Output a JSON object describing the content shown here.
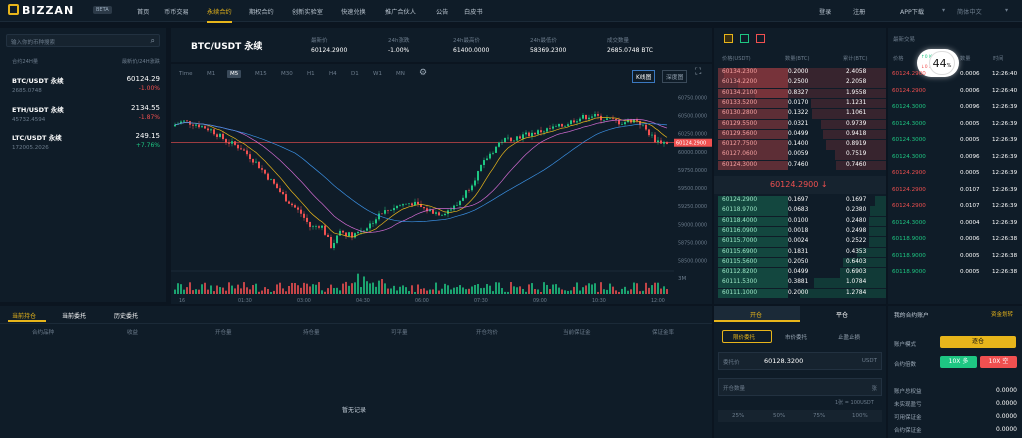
{
  "nav": {
    "logo": "BIZZAN",
    "beta": "BETA",
    "items": [
      "首页",
      "币币交易",
      "永续合约",
      "期权合约",
      "创新实验室",
      "快速兑换",
      "推广合伙人",
      "公告",
      "白皮书"
    ],
    "active_index": 2,
    "right": [
      "登录",
      "注册",
      "APP下载",
      "简体中文"
    ]
  },
  "left": {
    "search_placeholder": "输入你的币种搜索",
    "head_left": "合约24H量",
    "head_right": "最新价/24H涨跌",
    "symbols": [
      {
        "name": "BTC/USDT 永续",
        "vol": "2685.0748",
        "price": "60124.29",
        "change": "-1.00%",
        "dir": "down"
      },
      {
        "name": "ETH/USDT 永续",
        "vol": "45732.4594",
        "price": "2134.55",
        "change": "-1.87%",
        "dir": "down"
      },
      {
        "name": "LTC/USDT 永续",
        "vol": "172005.2026",
        "price": "249.15",
        "change": "+7.76%",
        "dir": "up"
      }
    ]
  },
  "ticker": {
    "symbol": "BTC/USDT 永续",
    "stats": [
      {
        "label": "最新价",
        "value": "60124.2900",
        "color": "red"
      },
      {
        "label": "24h涨跌",
        "value": "-1.00%",
        "color": "red"
      },
      {
        "label": "24h最高价",
        "value": "61400.0000",
        "color": "white"
      },
      {
        "label": "24h最低价",
        "value": "58369.2300",
        "color": "white"
      },
      {
        "label": "成交数量",
        "value": "2685.0748 BTC",
        "color": "white"
      }
    ]
  },
  "chart_toolbar": {
    "intervals": [
      "Time",
      "M1",
      "M5",
      "M15",
      "M30",
      "H1",
      "H4",
      "D1",
      "W1",
      "MN"
    ],
    "active_interval": "M5",
    "kline_btn": "K线图",
    "depth_btn": "深度图"
  },
  "chart_data": {
    "type": "candlestick",
    "xlabels": [
      "16",
      "01:30",
      "03:00",
      "04:30",
      "06:00",
      "07:30",
      "09:00",
      "10:30",
      "12:00"
    ],
    "ylabels": [
      "60750.0000",
      "60500.0000",
      "60250.0000",
      "60000.0000",
      "59750.0000",
      "59500.0000",
      "59250.0000",
      "59000.0000",
      "58750.0000",
      "58500.0000"
    ],
    "last_price_label": "60124.2900",
    "volume_label": "3M"
  },
  "orderbook": {
    "headers": [
      "价格(USDT)",
      "数量(BTC)",
      "累计(BTC)"
    ],
    "asks": [
      [
        "60134.2300",
        "0.2000",
        "2.4058"
      ],
      [
        "60134.2200",
        "0.2500",
        "2.2058"
      ],
      [
        "60134.2100",
        "0.8327",
        "1.9558"
      ],
      [
        "60133.5200",
        "0.0170",
        "1.1231"
      ],
      [
        "60130.2800",
        "0.1322",
        "1.1061"
      ],
      [
        "60129.5500",
        "0.0321",
        "0.9739"
      ],
      [
        "60129.5600",
        "0.0499",
        "0.9418"
      ],
      [
        "60127.7500",
        "0.1400",
        "0.8919"
      ],
      [
        "60127.0600",
        "0.0059",
        "0.7519"
      ],
      [
        "60124.3000",
        "0.7460",
        "0.7460"
      ]
    ],
    "mid_price": "60124.2900 ↓",
    "bids": [
      [
        "60124.2900",
        "0.1697",
        "0.1697"
      ],
      [
        "60118.9700",
        "0.0683",
        "0.2380"
      ],
      [
        "60118.4000",
        "0.0100",
        "0.2480"
      ],
      [
        "60116.0900",
        "0.0018",
        "0.2498"
      ],
      [
        "60115.7000",
        "0.0024",
        "0.2522"
      ],
      [
        "60115.6900",
        "0.1831",
        "0.4353"
      ],
      [
        "60115.5600",
        "0.2050",
        "0.6403"
      ],
      [
        "60112.8200",
        "0.0499",
        "0.6903"
      ],
      [
        "60111.5300",
        "0.3881",
        "1.0784"
      ],
      [
        "60111.1000",
        "0.2000",
        "1.2784"
      ]
    ]
  },
  "trades": {
    "title": "最新交易",
    "headers": [
      "价格",
      "数量",
      "时间"
    ],
    "rows": [
      [
        "60124.2900",
        "0.0006",
        "12:26:40",
        "red"
      ],
      [
        "60124.2900",
        "0.0006",
        "12:26:40",
        "red"
      ],
      [
        "60124.3000",
        "0.0096",
        "12:26:39",
        "green"
      ],
      [
        "60124.3000",
        "0.0005",
        "12:26:39",
        "green"
      ],
      [
        "60124.3000",
        "0.0005",
        "12:26:39",
        "green"
      ],
      [
        "60124.3000",
        "0.0096",
        "12:26:39",
        "green"
      ],
      [
        "60124.2900",
        "0.0005",
        "12:26:39",
        "red"
      ],
      [
        "60124.2900",
        "0.0107",
        "12:26:39",
        "red"
      ],
      [
        "60124.2900",
        "0.0107",
        "12:26:39",
        "red"
      ],
      [
        "60124.3000",
        "0.0004",
        "12:26:39",
        "green"
      ],
      [
        "60118.9000",
        "0.0006",
        "12:26:38",
        "green"
      ],
      [
        "60118.9000",
        "0.0005",
        "12:26:38",
        "green"
      ],
      [
        "60118.9000",
        "0.0005",
        "12:26:38",
        "green"
      ]
    ],
    "speed_badge": "44",
    "speed_unit": "%",
    "speed_up": "0",
    "speed_down": "0",
    "speed_unit_label": "K/s"
  },
  "positions": {
    "tabs": [
      "当前持仓",
      "当前委托",
      "历史委托"
    ],
    "columns": [
      "合约品种",
      "收益",
      "开仓量",
      "持仓量",
      "可平量",
      "开仓均价",
      "当前保证金",
      "保证金率"
    ],
    "empty": "暂无记录"
  },
  "order_form": {
    "tabs": [
      "开仓",
      "平仓"
    ],
    "subtabs": [
      "限价委托",
      "市价委托",
      "止盈止损"
    ],
    "price_label": "委托价",
    "price_value": "60128.3200",
    "price_unit": "USDT",
    "qty_label": "开仓数量",
    "qty_unit": "张",
    "contract_note": "1张 = 100USDT",
    "percents": [
      "25%",
      "50%",
      "75%",
      "100%"
    ]
  },
  "account": {
    "title": "我的合约账户",
    "transfer": "资金划转",
    "mode_label": "账户模式",
    "mode_value": "逐仓",
    "leverage_label": "合约倍数",
    "long_btn": "10X 多",
    "short_btn": "10X 空",
    "items": [
      {
        "label": "账户总权益",
        "value": "0.0000"
      },
      {
        "label": "未实现盈亏",
        "value": "0.0000"
      },
      {
        "label": "可用保证金",
        "value": "0.0000"
      },
      {
        "label": "合约保证金",
        "value": "0.0000"
      }
    ]
  },
  "colors": {
    "accent": "#e7b51b",
    "up": "#1ec682",
    "down": "#f05050",
    "bg": "#0b1520",
    "panel": "#0f1c28"
  }
}
